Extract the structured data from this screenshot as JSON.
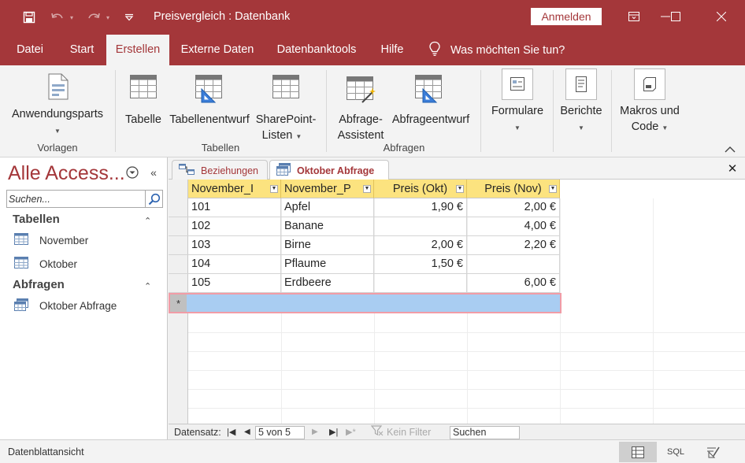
{
  "window": {
    "title": "Preisvergleich : Datenbank",
    "signin_label": "Anmelden"
  },
  "menu": {
    "tabs": [
      "Datei",
      "Start",
      "Erstellen",
      "Externe Daten",
      "Datenbanktools",
      "Hilfe"
    ],
    "active": "Erstellen",
    "tell_me": "Was möchten Sie tun?"
  },
  "ribbon": {
    "groups": {
      "vorlagen": "Vorlagen",
      "tabellen": "Tabellen",
      "abfragen": "Abfragen"
    },
    "buttons": {
      "anwendungsparts": "Anwendungsparts",
      "tabelle": "Tabelle",
      "tabellenentwurf": "Tabellenentwurf",
      "sharepoint_1": "SharePoint-",
      "sharepoint_2": "Listen",
      "abfrage_assistent_1": "Abfrage-",
      "abfrage_assistent_2": "Assistent",
      "abfrageentwurf": "Abfrageentwurf",
      "formulare": "Formulare",
      "berichte": "Berichte",
      "makros_1": "Makros und",
      "makros_2": "Code"
    }
  },
  "nav": {
    "title": "Alle Access...",
    "search_placeholder": "Suchen...",
    "sections": [
      {
        "label": "Tabellen",
        "items": [
          "November",
          "Oktober"
        ]
      },
      {
        "label": "Abfragen",
        "items": [
          "Oktober Abfrage"
        ]
      }
    ]
  },
  "doc_tabs": [
    {
      "label": "Beziehungen",
      "active": false
    },
    {
      "label": "Oktober Abfrage",
      "active": true
    }
  ],
  "datasheet": {
    "columns": [
      "November_I",
      "November_P",
      "Preis (Okt)",
      "Preis (Nov)"
    ],
    "rows": [
      [
        "101",
        "Apfel",
        "1,90 €",
        "2,00 €"
      ],
      [
        "102",
        "Banane",
        "",
        "4,00 €"
      ],
      [
        "103",
        "Birne",
        "2,00 €",
        "2,20 €"
      ],
      [
        "104",
        "Pflaume",
        "1,50 €",
        ""
      ],
      [
        "105",
        "Erdbeere",
        "",
        "6,00 €"
      ]
    ],
    "new_row_marker": "*"
  },
  "record_nav": {
    "label": "Datensatz:",
    "position": "5 von 5",
    "filter_label": "Kein Filter",
    "search_value": "Suchen"
  },
  "status": {
    "text": "Datenblattansicht",
    "sql_label": "SQL"
  },
  "colors": {
    "accent": "#a4373a",
    "header_fill": "#fce37f",
    "new_row_fill": "#a9cdf2"
  }
}
